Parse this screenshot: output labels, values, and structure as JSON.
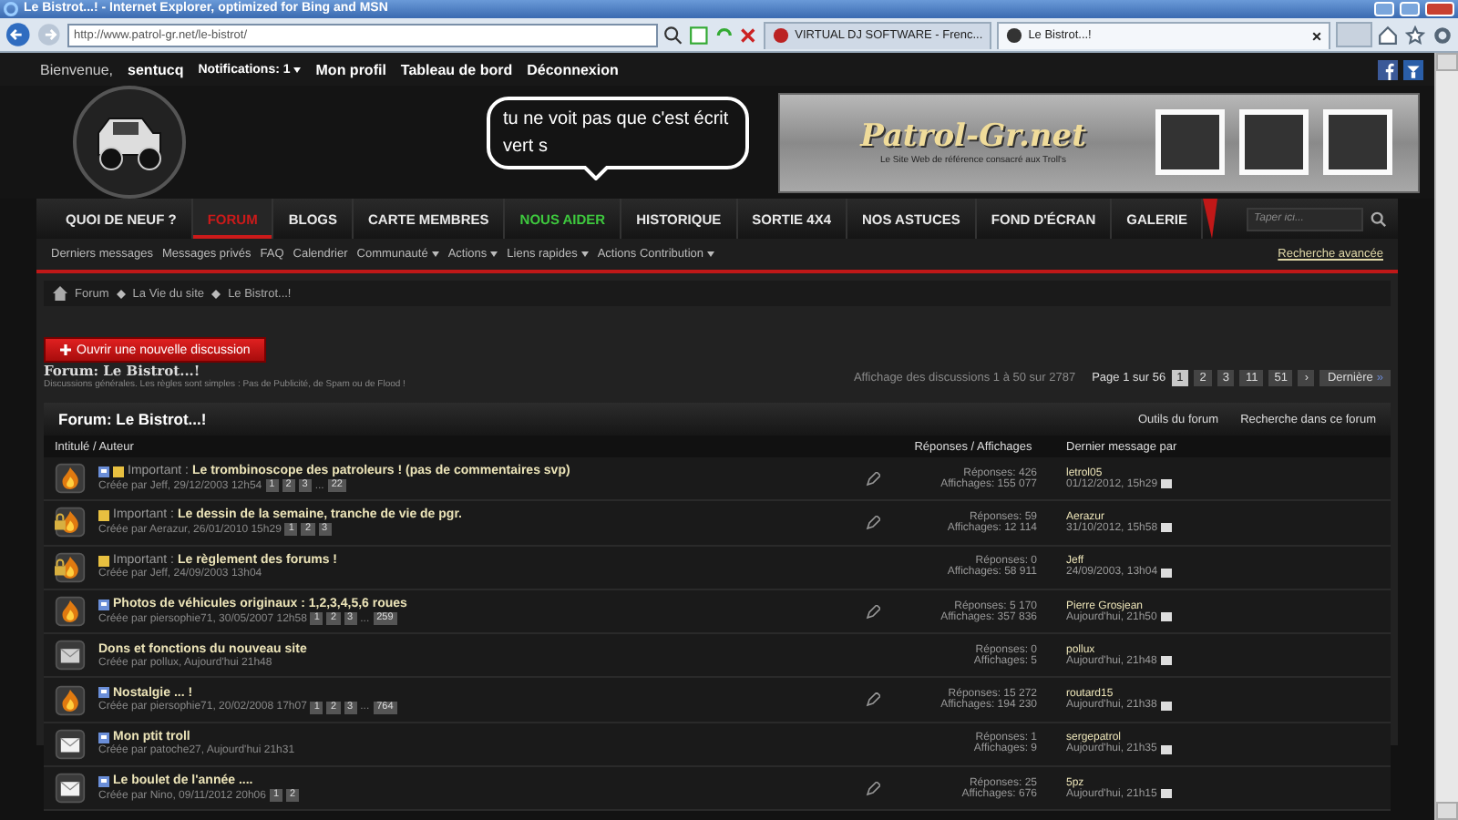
{
  "browser": {
    "title": "Le Bistrot...! - Internet Explorer, optimized for Bing and MSN",
    "address": "http://www.patrol-gr.net/le-bistrot/",
    "tabs": [
      {
        "label": "VIRTUAL DJ SOFTWARE - Frenc...",
        "selected": false
      },
      {
        "label": "Le Bistrot...!",
        "selected": true
      }
    ],
    "tab_close": "×"
  },
  "topbar": {
    "greeting": "Bienvenue,",
    "user": "sentucq",
    "notifications": "Notifications: 1",
    "links": [
      "Mon profil",
      "Tableau de bord",
      "Déconnexion"
    ]
  },
  "header": {
    "bubble": "tu ne voit pas que c'est écrit vert s",
    "banner_title": "Patrol-Gr.net",
    "banner_tagline": "Le Site Web de référence consacré aux Troll's"
  },
  "nav": {
    "items": [
      {
        "label": "QUOI DE NEUF ?",
        "selected": false,
        "color": "#e8e8e8"
      },
      {
        "label": "FORUM",
        "selected": true,
        "color": "#cc1a1a"
      },
      {
        "label": "BLOGS",
        "selected": false,
        "color": "#e8e8e8"
      },
      {
        "label": "CARTE MEMBRES",
        "selected": false,
        "color": "#e8e8e8"
      },
      {
        "label": "NOUS AIDER",
        "selected": false,
        "color": "#3ec93e"
      },
      {
        "label": "HISTORIQUE",
        "selected": false,
        "color": "#e8e8e8"
      },
      {
        "label": "SORTIE 4X4",
        "selected": false,
        "color": "#e8e8e8"
      },
      {
        "label": "NOS ASTUCES",
        "selected": false,
        "color": "#e8e8e8"
      },
      {
        "label": "FOND D'ÉCRAN",
        "selected": false,
        "color": "#e8e8e8"
      },
      {
        "label": "GALERIE",
        "selected": false,
        "color": "#e8e8e8"
      }
    ],
    "search": {
      "placeholder": "Taper ici..."
    }
  },
  "subnav": {
    "links": [
      {
        "label": "Derniers messages",
        "dropdown": false
      },
      {
        "label": "Messages privés",
        "dropdown": false
      },
      {
        "label": "FAQ",
        "dropdown": false
      },
      {
        "label": "Calendrier",
        "dropdown": false
      },
      {
        "label": "Communauté",
        "dropdown": true
      },
      {
        "label": "Actions",
        "dropdown": true
      },
      {
        "label": "Liens rapides",
        "dropdown": true
      },
      {
        "label": "Actions Contribution",
        "dropdown": true
      }
    ],
    "advanced_search": "Recherche avancée"
  },
  "breadcrumb": [
    "Forum",
    "La Vie du site",
    "Le Bistrot...!"
  ],
  "new_thread_button": "Ouvrir une nouvelle discussion",
  "forum": {
    "title": "Forum: Le Bistrot...!",
    "description": "Discussions générales. Les règles sont simples : Pas de Publicité, de Spam ou de Flood !"
  },
  "pagination": {
    "summary": "Affichage des discussions 1 à 50 sur 2787",
    "label": "Page 1 sur 56",
    "pages": [
      {
        "label": "1",
        "selected": true
      },
      {
        "label": "2",
        "selected": false
      },
      {
        "label": "3",
        "selected": false
      },
      {
        "label": "11",
        "selected": false
      },
      {
        "label": "51",
        "selected": false
      }
    ],
    "next": "›",
    "last": "Dernière",
    "last_arrow": "»"
  },
  "thread_list": {
    "title": "Forum: Le Bistrot...!",
    "tools": [
      "Outils du forum",
      "Recherche dans ce forum"
    ],
    "columns": [
      "Intitulé / Auteur",
      "Réponses / Affichages",
      "Dernier message par"
    ],
    "threads": [
      {
        "kind": "hot",
        "post_icon": true,
        "sticky": true,
        "prefix": "Important :",
        "title": "Le trombinoscope des patroleurs ! (pas de commentaires svp)",
        "meta": "Créée par Jeff, 29/12/2003 12h54",
        "pages": [
          "1",
          "2",
          "3"
        ],
        "more": "...",
        "last_page": "22",
        "posted": true,
        "replies": "Réponses: 426",
        "views": "Affichages: 155 077",
        "last_by": "letrol05",
        "last_date": "01/12/2012, 15h29"
      },
      {
        "kind": "hot_locked",
        "post_icon": false,
        "sticky": true,
        "prefix": "Important :",
        "title": "Le dessin de la semaine, tranche de vie de pgr.",
        "meta": "Créée par Aerazur, 26/01/2010 15h29",
        "pages": [
          "1",
          "2",
          "3"
        ],
        "posted": true,
        "replies": "Réponses: 59",
        "views": "Affichages: 12 114",
        "last_by": "Aerazur",
        "last_date": "31/10/2012, 15h58"
      },
      {
        "kind": "hot_locked",
        "post_icon": false,
        "sticky": true,
        "prefix": "Important :",
        "title": "Le règlement des forums !",
        "meta": "Créée par Jeff, 24/09/2003 13h04",
        "posted": false,
        "replies": "Réponses: 0",
        "views": "Affichages: 58 911",
        "last_by": "Jeff",
        "last_date": "24/09/2003, 13h04"
      },
      {
        "kind": "hot",
        "post_icon": true,
        "sticky": false,
        "title": "Photos de véhicules originaux : 1,2,3,4,5,6 roues",
        "meta": "Créée par piersophie71, 30/05/2007 12h58",
        "pages": [
          "1",
          "2",
          "3"
        ],
        "more": "...",
        "last_page": "259",
        "posted": true,
        "replies": "Réponses: 5 170",
        "views": "Affichages: 357 836",
        "last_by": "Pierre Grosjean",
        "last_date": "Aujourd'hui, 21h50"
      },
      {
        "kind": "new",
        "post_icon": false,
        "sticky": false,
        "title": "Dons et fonctions du nouveau site",
        "meta": "Créée par pollux, Aujourd'hui 21h48",
        "posted": false,
        "replies": "Réponses: 0",
        "views": "Affichages: 5",
        "last_by": "pollux",
        "last_date": "Aujourd'hui, 21h48"
      },
      {
        "kind": "hot",
        "post_icon": true,
        "sticky": false,
        "title": "Nostalgie ... !",
        "meta": "Créée par piersophie71, 20/02/2008 17h07",
        "pages": [
          "1",
          "2",
          "3"
        ],
        "more": "...",
        "last_page": "764",
        "posted": true,
        "replies": "Réponses: 15 272",
        "views": "Affichages: 194 230",
        "last_by": "routard15",
        "last_date": "Aujourd'hui, 21h38"
      },
      {
        "kind": "read",
        "post_icon": true,
        "sticky": false,
        "title": "Mon ptit troll",
        "meta": "Créée par patoche27, Aujourd'hui 21h31",
        "posted": false,
        "replies": "Réponses: 1",
        "views": "Affichages: 9",
        "last_by": "sergepatrol",
        "last_date": "Aujourd'hui, 21h35"
      },
      {
        "kind": "read",
        "post_icon": true,
        "sticky": false,
        "title": "Le boulet de l'année ....",
        "meta": "Créée par Nino, 09/11/2012 20h06",
        "pages": [
          "1",
          "2"
        ],
        "posted": true,
        "replies": "Réponses: 25",
        "views": "Affichages: 676",
        "last_by": "5pz",
        "last_date": "Aujourd'hui, 21h15"
      }
    ]
  }
}
